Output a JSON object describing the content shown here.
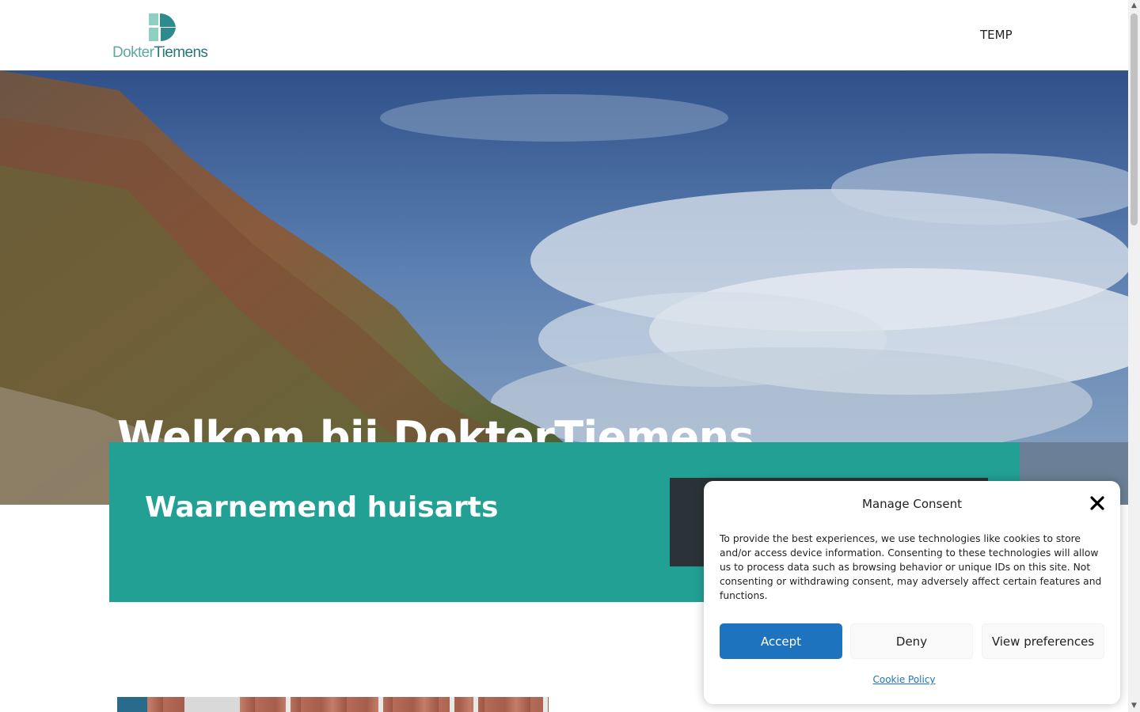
{
  "header": {
    "logo": {
      "text_part1": "Dokter",
      "text_part2": "Tiemens",
      "color_light": "#5fa9a2",
      "color_dark": "#28767b"
    },
    "nav": [
      {
        "label": "TEMP"
      }
    ]
  },
  "hero": {
    "title": "Welkom bij DokterTiemens"
  },
  "band": {
    "title": "Waarnemend huisarts",
    "color": "#22a094"
  },
  "consent": {
    "title": "Manage Consent",
    "text": "To provide the best experiences, we use technologies like cookies to store and/or access device information. Consenting to these technologies will allow us to process data such as browsing behavior or unique IDs on this site. Not consenting or withdrawing consent, may adversely affect certain features and functions.",
    "accept_label": "Accept",
    "deny_label": "Deny",
    "preferences_label": "View preferences",
    "policy_link": "Cookie Policy",
    "close_icon": "close-icon",
    "accent": "#1e73be"
  }
}
